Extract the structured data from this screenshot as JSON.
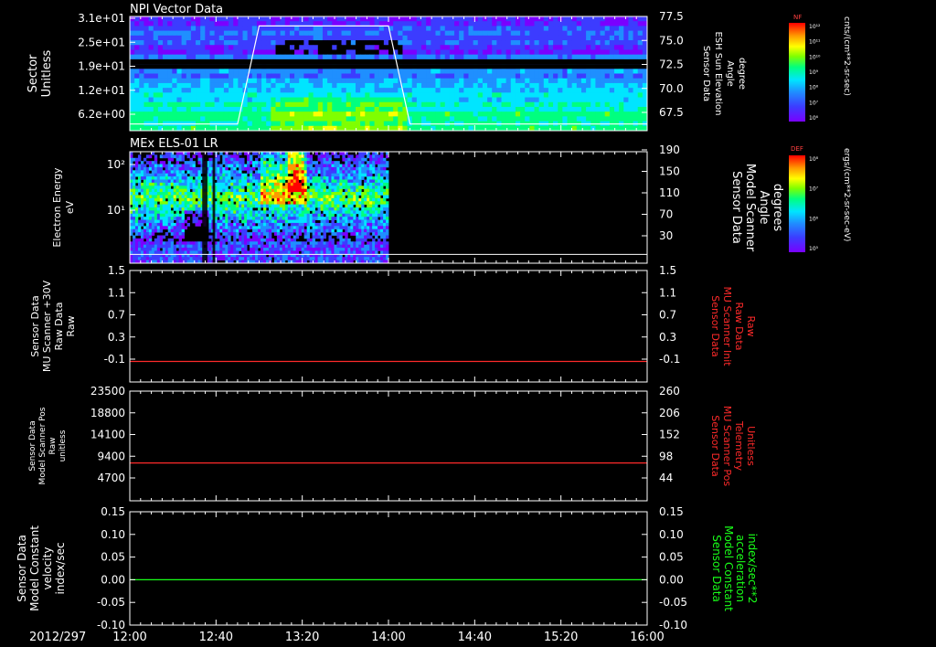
{
  "date_label": "2012/297",
  "time_ticks": [
    "12:00",
    "12:40",
    "13:20",
    "14:00",
    "14:40",
    "15:20",
    "16:00"
  ],
  "colors": {
    "background": "#000000",
    "axis": "#ffffff",
    "red_trace": "#ff2a2a",
    "green_trace": "#19ff19",
    "spectro_palette": [
      "#7a00ff",
      "#3c3cff",
      "#1f8fff",
      "#00e5ff",
      "#00ff7f",
      "#7fff00",
      "#ffff00",
      "#ff9900",
      "#ff0000"
    ]
  },
  "colorbars": [
    {
      "badge": "NF",
      "unit_label": "cnts/(cm**2-sr-sec)",
      "tick_labels": [
        "10¹²",
        "10¹¹",
        "10¹⁰",
        "10⁹",
        "10⁸",
        "10⁷",
        "10⁶"
      ]
    },
    {
      "badge": "DEF",
      "unit_label": "ergs/(cm**2-sr-sec-eV)",
      "tick_labels": [
        "10⁸",
        "10⁷",
        "10⁶",
        "10⁵"
      ]
    }
  ],
  "chart_data": [
    {
      "type": "heatmap",
      "title": "NPI Vector Data",
      "left_axis_labels": [
        "Sector",
        "Unitless"
      ],
      "left_ticks": [
        "3.1e+01",
        "2.5e+01",
        "1.9e+01",
        "1.2e+01",
        "6.2e+00"
      ],
      "right_axis_labels": [
        "Sensor Data",
        "ESH Sun Elevation",
        "Angle",
        "degree"
      ],
      "right_ticks": [
        "77.5",
        "75.0",
        "72.5",
        "70.0",
        "67.5"
      ],
      "overlay_line": {
        "name": "ESH Sun Elevation Angle",
        "x": [
          "12:00",
          "12:50",
          "13:00",
          "14:00",
          "14:10",
          "16:00"
        ],
        "y": [
          66.2,
          66.2,
          76.5,
          76.5,
          66.2,
          66.2
        ],
        "ylim": [
          65.5,
          77.5
        ]
      }
    },
    {
      "type": "heatmap",
      "title": "MEx ELS-01 LR",
      "left_axis_labels": [
        "Electron Energy",
        "eV"
      ],
      "left_ticks": [
        "10²",
        "10¹"
      ],
      "right_axis_labels": [
        "Sensor Data",
        "Model Scanner",
        "Angle",
        "degrees"
      ],
      "right_ticks": [
        "190",
        "150",
        "110",
        "70",
        "30"
      ],
      "data_extent_x": [
        "12:00",
        "14:00"
      ],
      "overlay_line": {
        "name": "Model Scanner Angle",
        "x": [
          "12:00",
          "16:00"
        ],
        "y": [
          15,
          15
        ],
        "ylim": [
          0,
          190
        ]
      }
    },
    {
      "type": "line",
      "left_axis_labels": [
        "Sensor Data",
        "MU Scanner +30V",
        "Raw Data",
        "Raw"
      ],
      "left_ticks": [
        "1.5",
        "1.1",
        "0.7",
        "0.3",
        "-0.1"
      ],
      "right_axis_labels": [
        "Sensor Data",
        "MU Scanner Init",
        "Raw Data",
        "Raw"
      ],
      "right_ticks": [
        "1.5",
        "1.1",
        "0.7",
        "0.3",
        "-0.1"
      ],
      "ylim": [
        -0.4,
        1.5
      ],
      "series": [
        {
          "x": [
            "12:00",
            "16:00"
          ],
          "y": [
            -0.05,
            -0.05
          ]
        }
      ]
    },
    {
      "type": "line",
      "left_axis_labels": [
        "Sensor Data",
        "Model Scanner Pos",
        "Raw",
        "unitless"
      ],
      "left_ticks": [
        "23500",
        "18800",
        "14100",
        "9400",
        "4700"
      ],
      "right_axis_labels": [
        "Sensor Data",
        "MU Scanner Pos",
        "Telemetry",
        "Unitless"
      ],
      "right_ticks": [
        "260",
        "206",
        "152",
        "98",
        "44"
      ],
      "ylim": [
        0,
        23500
      ],
      "series": [
        {
          "x": [
            "12:00",
            "16:00"
          ],
          "y": [
            8100,
            8100
          ]
        }
      ]
    },
    {
      "type": "line",
      "left_axis_labels": [
        "Sensor Data",
        "Model Constant",
        "velocity",
        "index/sec"
      ],
      "left_ticks": [
        "0.15",
        "0.10",
        "0.05",
        "0.00",
        "-0.05",
        "-0.10"
      ],
      "right_axis_labels": [
        "Sensor Data",
        "Model Constant",
        "acceleration",
        "index/sec**2"
      ],
      "right_ticks": [
        "0.15",
        "0.10",
        "0.05",
        "0.00",
        "-0.05",
        "-0.10"
      ],
      "ylim": [
        -0.1,
        0.15
      ],
      "series": [
        {
          "x": [
            "12:00",
            "16:00"
          ],
          "y": [
            0.0,
            0.0
          ]
        }
      ]
    }
  ]
}
